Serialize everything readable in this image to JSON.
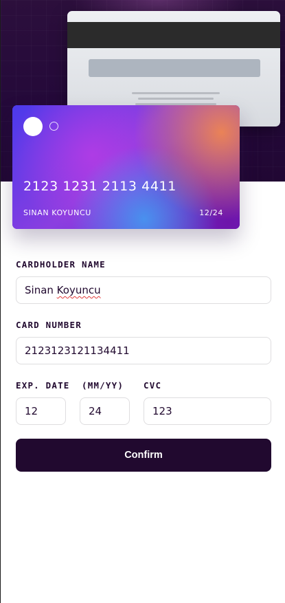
{
  "card_back": {
    "stripe": "magnetic-stripe",
    "signature": "signature-panel"
  },
  "card_front": {
    "number": "2123 1231 2113 4411",
    "holder": "SINAN KOYUNCU",
    "expiry": "12/24"
  },
  "form": {
    "name_label": "CARDHOLDER NAME",
    "name_value": "Sinan Koyuncu",
    "name_value_plain": "Sinan ",
    "name_value_misspelled": "Koyuncu",
    "number_label": "CARD NUMBER",
    "number_value": "2123123121134411",
    "expiry_label": "EXP. DATE  (MM/YY)",
    "expiry_month": "12",
    "expiry_year": "24",
    "cvc_label": "CVC",
    "cvc_value": "123",
    "confirm_label": "Confirm"
  },
  "colors": {
    "accent_dark": "#21092f",
    "border": "#dedddf",
    "spellcheck": "#e23a3a"
  }
}
